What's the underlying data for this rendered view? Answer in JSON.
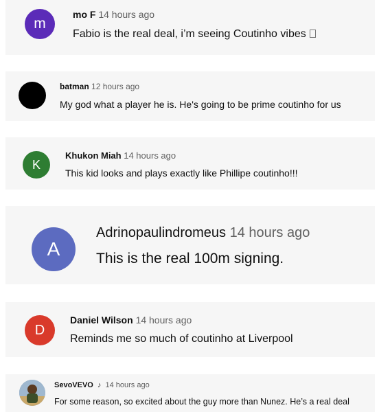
{
  "comments": [
    {
      "author": "mo F",
      "time": "14 hours ago",
      "text": "Fabio is the real deal, i’m seeing Coutinho vibes",
      "avatar_letter": "m",
      "avatar_color": "#5b2bb8",
      "trailing_icon": "missing-emoji-box-icon"
    },
    {
      "author": "batman",
      "time": "12 hours ago",
      "text": "My god what a player he is. He's going to be prime coutinho for us",
      "avatar_letter": "",
      "avatar_color": "#000000"
    },
    {
      "author": "Khukon Miah",
      "time": "14 hours ago",
      "text": "This kid looks and plays exactly like Phillipe coutinho!!!",
      "avatar_letter": "K",
      "avatar_color": "#2e7d32"
    },
    {
      "author": "Adrinopaulindromeus",
      "time": "14 hours ago",
      "text": "This is the real 100m signing.",
      "avatar_letter": "A",
      "avatar_color": "#5c6bc0"
    },
    {
      "author": "Daniel Wilson",
      "time": "14 hours ago",
      "text": "Reminds me so much of coutinho at Liverpool",
      "avatar_letter": "D",
      "avatar_color": "#d93a2b"
    },
    {
      "author": "SevoVEVO",
      "time": "14 hours ago",
      "text": "For some reason, so excited about the guy more than Nunez. He’s a real deal",
      "avatar_letter": "",
      "avatar_color": "#6f8fae",
      "badge_icon": "music-note-icon"
    }
  ]
}
